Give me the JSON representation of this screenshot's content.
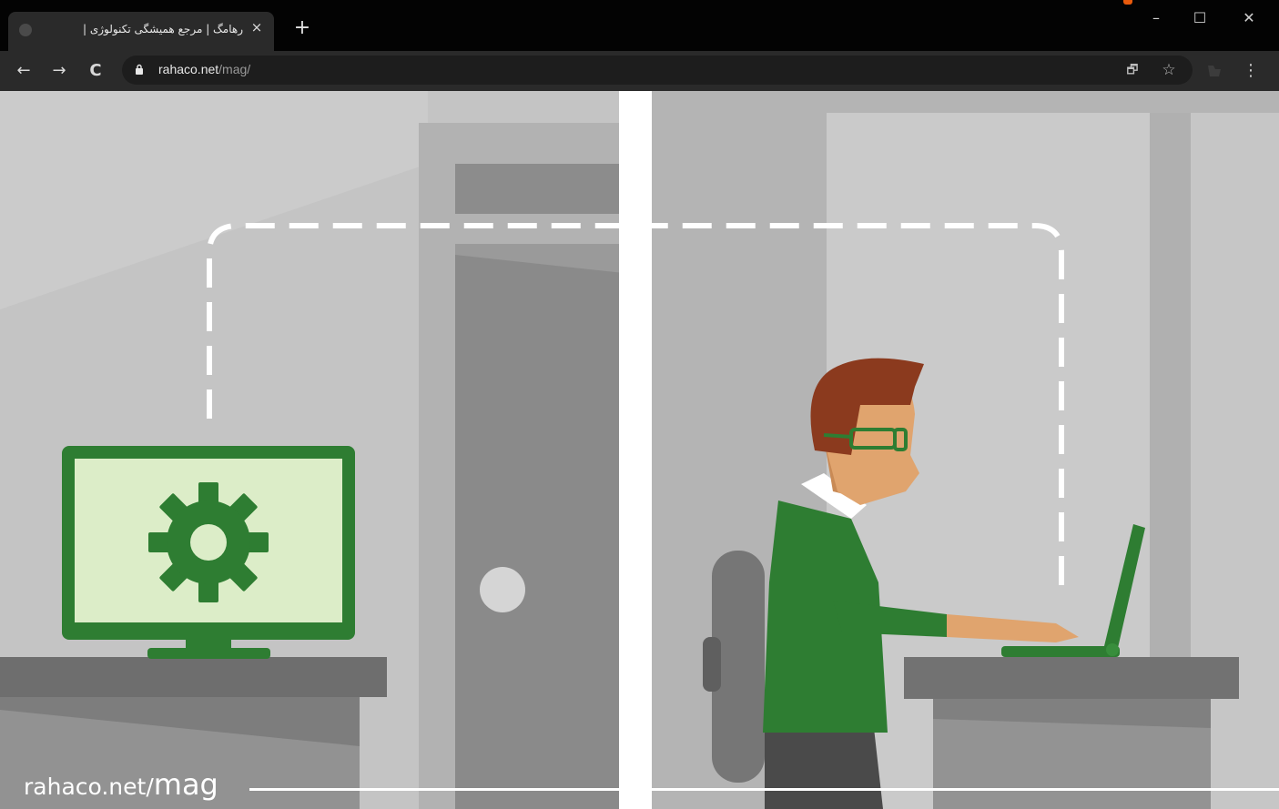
{
  "browser": {
    "tab": {
      "title": "رهامگ | مرجع همیشگی تکنولوژی |",
      "close": "×"
    },
    "new_tab": "+",
    "window_controls": {
      "minimize": "–",
      "maximize": "☐",
      "close": "✕"
    },
    "nav": {
      "back": "←",
      "forward": "→",
      "reload": "C"
    },
    "address": {
      "domain": "rahaco.net",
      "path": "/mag/"
    },
    "omnibox_icons": {
      "translate": "🗗",
      "bookmark": "☆"
    },
    "menu": "⋮"
  },
  "content": {
    "watermark": {
      "site": "rahaco.net/",
      "section": "mag"
    },
    "colors": {
      "accent_green": "#2e7d32",
      "screen_green": "#dcedc8",
      "hair": "#8b3a1e",
      "skin": "#e0a46e",
      "sweater": "#2e7d32"
    },
    "icons": [
      "gear-icon",
      "computer-monitor",
      "laptop",
      "door",
      "office-chair"
    ]
  }
}
